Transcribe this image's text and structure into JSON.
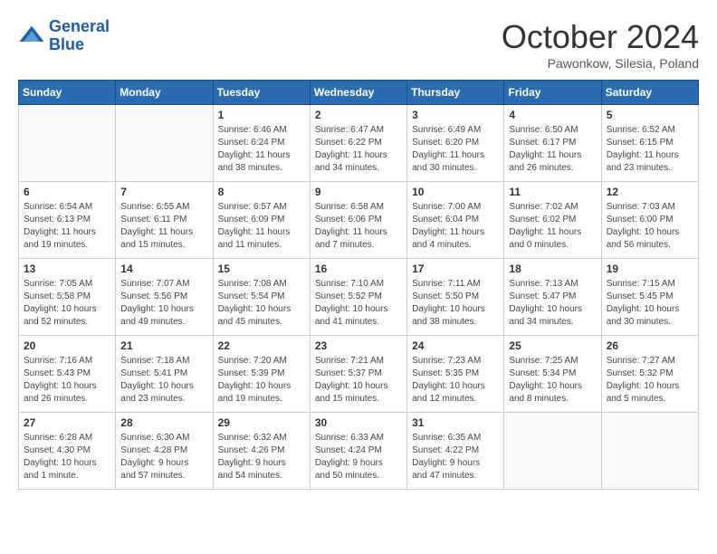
{
  "header": {
    "logo_line1": "General",
    "logo_line2": "Blue",
    "month": "October 2024",
    "location": "Pawonkow, Silesia, Poland"
  },
  "days_of_week": [
    "Sunday",
    "Monday",
    "Tuesday",
    "Wednesday",
    "Thursday",
    "Friday",
    "Saturday"
  ],
  "weeks": [
    [
      {
        "day": "",
        "content": ""
      },
      {
        "day": "",
        "content": ""
      },
      {
        "day": "1",
        "content": "Sunrise: 6:46 AM\nSunset: 6:24 PM\nDaylight: 11 hours\nand 38 minutes."
      },
      {
        "day": "2",
        "content": "Sunrise: 6:47 AM\nSunset: 6:22 PM\nDaylight: 11 hours\nand 34 minutes."
      },
      {
        "day": "3",
        "content": "Sunrise: 6:49 AM\nSunset: 6:20 PM\nDaylight: 11 hours\nand 30 minutes."
      },
      {
        "day": "4",
        "content": "Sunrise: 6:50 AM\nSunset: 6:17 PM\nDaylight: 11 hours\nand 26 minutes."
      },
      {
        "day": "5",
        "content": "Sunrise: 6:52 AM\nSunset: 6:15 PM\nDaylight: 11 hours\nand 23 minutes."
      }
    ],
    [
      {
        "day": "6",
        "content": "Sunrise: 6:54 AM\nSunset: 6:13 PM\nDaylight: 11 hours\nand 19 minutes."
      },
      {
        "day": "7",
        "content": "Sunrise: 6:55 AM\nSunset: 6:11 PM\nDaylight: 11 hours\nand 15 minutes."
      },
      {
        "day": "8",
        "content": "Sunrise: 6:57 AM\nSunset: 6:09 PM\nDaylight: 11 hours\nand 11 minutes."
      },
      {
        "day": "9",
        "content": "Sunrise: 6:58 AM\nSunset: 6:06 PM\nDaylight: 11 hours\nand 7 minutes."
      },
      {
        "day": "10",
        "content": "Sunrise: 7:00 AM\nSunset: 6:04 PM\nDaylight: 11 hours\nand 4 minutes."
      },
      {
        "day": "11",
        "content": "Sunrise: 7:02 AM\nSunset: 6:02 PM\nDaylight: 11 hours\nand 0 minutes."
      },
      {
        "day": "12",
        "content": "Sunrise: 7:03 AM\nSunset: 6:00 PM\nDaylight: 10 hours\nand 56 minutes."
      }
    ],
    [
      {
        "day": "13",
        "content": "Sunrise: 7:05 AM\nSunset: 5:58 PM\nDaylight: 10 hours\nand 52 minutes."
      },
      {
        "day": "14",
        "content": "Sunrise: 7:07 AM\nSunset: 5:56 PM\nDaylight: 10 hours\nand 49 minutes."
      },
      {
        "day": "15",
        "content": "Sunrise: 7:08 AM\nSunset: 5:54 PM\nDaylight: 10 hours\nand 45 minutes."
      },
      {
        "day": "16",
        "content": "Sunrise: 7:10 AM\nSunset: 5:52 PM\nDaylight: 10 hours\nand 41 minutes."
      },
      {
        "day": "17",
        "content": "Sunrise: 7:11 AM\nSunset: 5:50 PM\nDaylight: 10 hours\nand 38 minutes."
      },
      {
        "day": "18",
        "content": "Sunrise: 7:13 AM\nSunset: 5:47 PM\nDaylight: 10 hours\nand 34 minutes."
      },
      {
        "day": "19",
        "content": "Sunrise: 7:15 AM\nSunset: 5:45 PM\nDaylight: 10 hours\nand 30 minutes."
      }
    ],
    [
      {
        "day": "20",
        "content": "Sunrise: 7:16 AM\nSunset: 5:43 PM\nDaylight: 10 hours\nand 26 minutes."
      },
      {
        "day": "21",
        "content": "Sunrise: 7:18 AM\nSunset: 5:41 PM\nDaylight: 10 hours\nand 23 minutes."
      },
      {
        "day": "22",
        "content": "Sunrise: 7:20 AM\nSunset: 5:39 PM\nDaylight: 10 hours\nand 19 minutes."
      },
      {
        "day": "23",
        "content": "Sunrise: 7:21 AM\nSunset: 5:37 PM\nDaylight: 10 hours\nand 15 minutes."
      },
      {
        "day": "24",
        "content": "Sunrise: 7:23 AM\nSunset: 5:35 PM\nDaylight: 10 hours\nand 12 minutes."
      },
      {
        "day": "25",
        "content": "Sunrise: 7:25 AM\nSunset: 5:34 PM\nDaylight: 10 hours\nand 8 minutes."
      },
      {
        "day": "26",
        "content": "Sunrise: 7:27 AM\nSunset: 5:32 PM\nDaylight: 10 hours\nand 5 minutes."
      }
    ],
    [
      {
        "day": "27",
        "content": "Sunrise: 6:28 AM\nSunset: 4:30 PM\nDaylight: 10 hours\nand 1 minute."
      },
      {
        "day": "28",
        "content": "Sunrise: 6:30 AM\nSunset: 4:28 PM\nDaylight: 9 hours\nand 57 minutes."
      },
      {
        "day": "29",
        "content": "Sunrise: 6:32 AM\nSunset: 4:26 PM\nDaylight: 9 hours\nand 54 minutes."
      },
      {
        "day": "30",
        "content": "Sunrise: 6:33 AM\nSunset: 4:24 PM\nDaylight: 9 hours\nand 50 minutes."
      },
      {
        "day": "31",
        "content": "Sunrise: 6:35 AM\nSunset: 4:22 PM\nDaylight: 9 hours\nand 47 minutes."
      },
      {
        "day": "",
        "content": ""
      },
      {
        "day": "",
        "content": ""
      }
    ]
  ]
}
